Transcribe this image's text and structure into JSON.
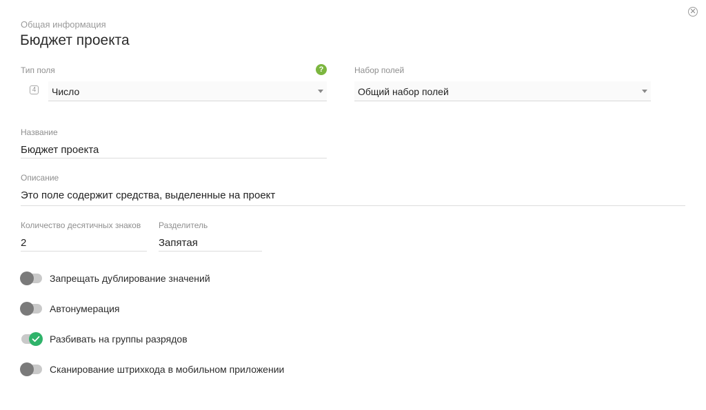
{
  "header": {
    "subtitle": "Общая информация",
    "title": "Бюджет проекта",
    "close_icon": "close-icon"
  },
  "field_type": {
    "label": "Тип поля",
    "help_icon": "help-icon",
    "help_glyph": "?",
    "type_glyph": "4",
    "value": "Число"
  },
  "field_set": {
    "label": "Набор полей",
    "value": "Общий набор полей"
  },
  "name": {
    "label": "Название",
    "value": "Бюджет проекта"
  },
  "description": {
    "label": "Описание",
    "value": "Это поле содержит средства, выделенные на проект"
  },
  "decimals": {
    "label": "Количество десятичных знаков",
    "value": "2"
  },
  "separator": {
    "label": "Разделитель",
    "value": "Запятая"
  },
  "toggles": [
    {
      "label": "Запрещать дублирование значений",
      "checked": false
    },
    {
      "label": "Автонумерация",
      "checked": false
    },
    {
      "label": "Разбивать на группы разрядов",
      "checked": true
    },
    {
      "label": "Сканирование штрихкода в мобильном приложении",
      "checked": false
    }
  ],
  "colors": {
    "accent_green": "#2fb36a",
    "help_green": "#7cb63f",
    "toggle_off": "#7a7a7a"
  }
}
